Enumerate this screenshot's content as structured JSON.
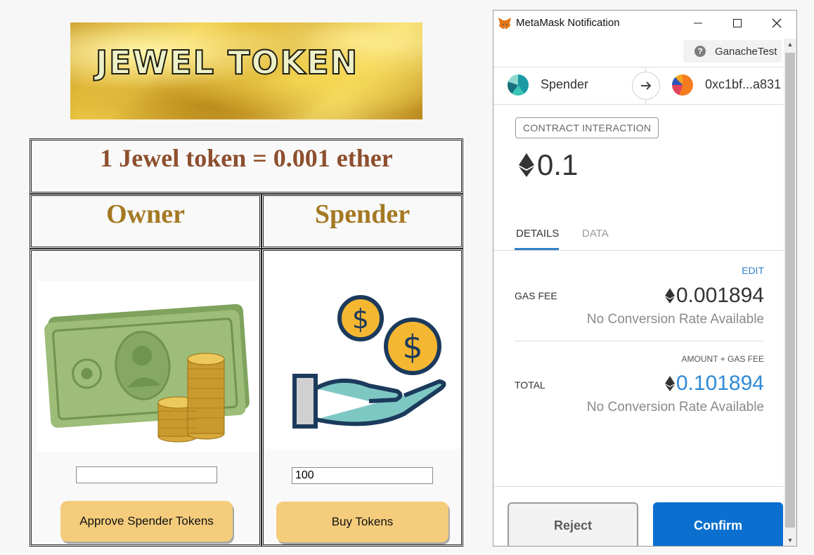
{
  "dapp": {
    "banner_text": "JEWEL TOKEN",
    "rate_text": "1 Jewel token = 0.001 ether",
    "owner": {
      "title": "Owner",
      "input_value": "",
      "button_label": "Approve Spender Tokens"
    },
    "spender": {
      "title": "Spender",
      "input_value": "100",
      "button_label": "Buy Tokens"
    }
  },
  "metamask": {
    "window_title": "MetaMask Notification",
    "network": "GanacheTest",
    "from_account": "Spender",
    "to_account": "0xc1bf...a831",
    "badge": "CONTRACT INTERACTION",
    "amount": "0.1",
    "tabs": [
      "DETAILS",
      "DATA"
    ],
    "edit_label": "EDIT",
    "gas_fee": {
      "label": "GAS FEE",
      "value": "0.001894",
      "conversion": "No Conversion Rate Available"
    },
    "total": {
      "caption": "AMOUNT + GAS FEE",
      "label": "TOTAL",
      "value": "0.101894",
      "conversion": "No Conversion Rate Available"
    },
    "reject_label": "Reject",
    "confirm_label": "Confirm"
  },
  "icons": {
    "eth": "ethereum-icon",
    "minimize": "minimize-icon",
    "maximize": "maximize-icon",
    "close": "close-icon",
    "fox": "metamask-fox-icon",
    "help": "help-icon",
    "arrow": "arrow-right-icon"
  },
  "colors": {
    "gold_button": "#f4cc7c",
    "rate_text": "#8e4f2e",
    "column_title": "#a47923",
    "confirm": "#0b6fcf",
    "total_value": "#2f8ad6"
  }
}
